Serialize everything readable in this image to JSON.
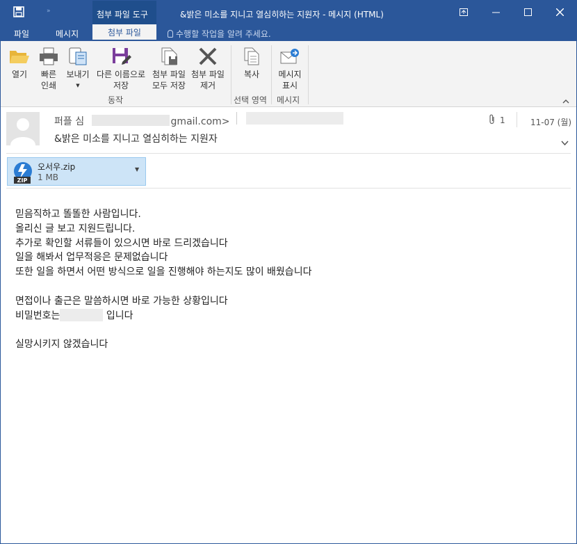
{
  "window": {
    "title": "&밝은 미소를 지니고 열심히하는 지원자 - 메시지 (HTML)",
    "context_tab": "첨부 파일 도구"
  },
  "tabs": {
    "file": "파일",
    "message": "메시지",
    "active": "첨부 파일",
    "tell_me": "수행할 작업을 알려 주세요."
  },
  "ribbon": {
    "open": "열기",
    "quick_print_1": "빠른",
    "quick_print_2": "인쇄",
    "send_to": "보내기",
    "save_as_1": "다른 이름으로",
    "save_as_2": "저장",
    "save_all_1": "첨부 파일",
    "save_all_2": "모두 저장",
    "remove_1": "첨부 파일",
    "remove_2": "제거",
    "group_actions": "동작",
    "copy": "복사",
    "group_select": "선택 영역",
    "show_msg_1": "메시지",
    "show_msg_2": "표시",
    "group_message": "메시지"
  },
  "header": {
    "sender_name": "퍼플 심",
    "sender_email_suffix": "gmail.com>",
    "subject": "&밝은 미소를 지니고 열심히하는 지원자",
    "attachment_count": "1",
    "date": "11-07 (월)"
  },
  "attachment": {
    "name": "오서우.zip",
    "size": "1 MB",
    "icon_label": "ZIP"
  },
  "body": {
    "lines": [
      "믿음직하고 똘똘한 사람입니다.",
      "올리신 글 보고 지원드립니다.",
      "추가로 확인할 서류들이 있으시면 바로 드리겠습니다",
      "일을 해봐서 업무적응은 문제없습니다",
      "또한 일을 하면서 어떤 방식으로 일을 진행해야 하는지도 많이 배웠습니다",
      "",
      "면접이나 출근은 말씀하시면 바로 가능한 상황입니다"
    ],
    "password_prefix": "비밀번호는",
    "password_suffix": " 입니다",
    "closing": "실망시키지 않겠습니다"
  },
  "colors": {
    "accent": "#2b579a",
    "attachment_bg": "#cde4f7"
  }
}
